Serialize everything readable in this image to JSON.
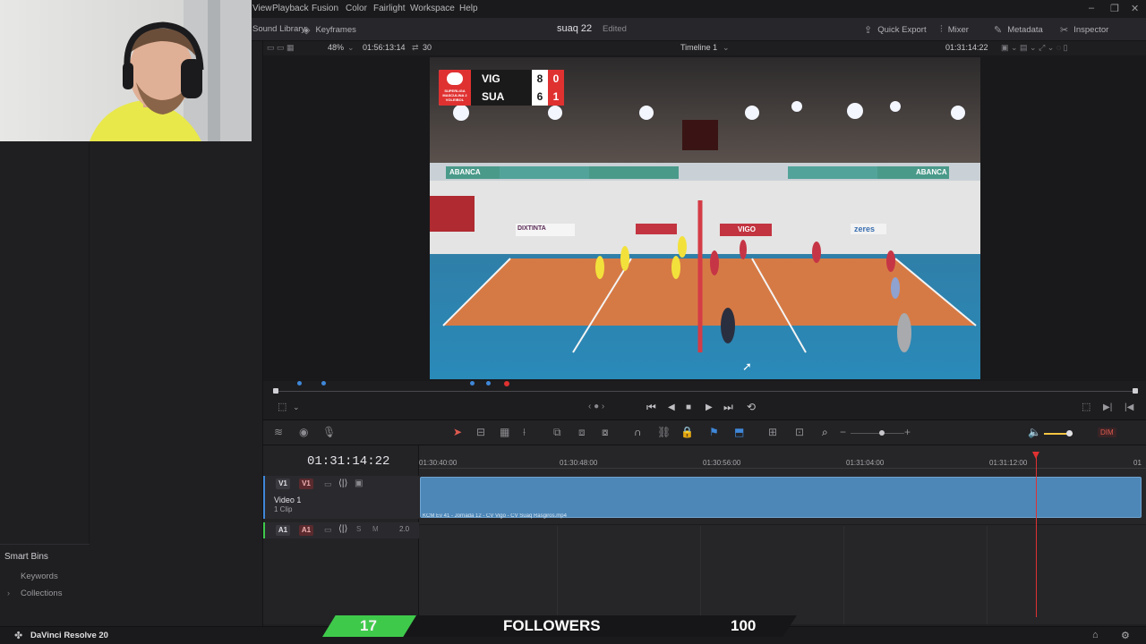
{
  "menu": {
    "items": [
      "View",
      "Playback",
      "Fusion",
      "Color",
      "Fairlight",
      "Workspace",
      "Help"
    ]
  },
  "toolbar": {
    "media_library": "Sound Library",
    "keyframes": "Keyframes",
    "project_title": "suaq 22",
    "project_status": "Edited",
    "quick_export": "Quick Export",
    "mixer": "Mixer",
    "metadata": "Metadata",
    "inspector": "Inspector"
  },
  "viewer": {
    "zoom": "48%",
    "source_timecode": "01:56:13:14",
    "fps": "30",
    "timeline_name": "Timeline 1",
    "record_timecode": "01:31:14:22"
  },
  "scoreboard": {
    "team1": "VIG",
    "team1_sets": "8",
    "team1_points": "0",
    "team2": "SUA",
    "team2_sets": "6",
    "team2_points": "1",
    "league": "SUPERLIGA MASCULINA 2 VOLEIBOL"
  },
  "court_banners": [
    "ABANCA",
    "ABANCA",
    "DIXTINTA",
    "VIGO",
    "zeres"
  ],
  "timeline": {
    "current_timecode": "01:31:14:22",
    "ruler_labels": [
      "01:30:40:00",
      "01:30:48:00",
      "01:30:56:00",
      "01:31:04:00",
      "01:31:12:00",
      "01"
    ],
    "video_track": {
      "tag1": "V1",
      "tag2": "V1",
      "name": "Video 1",
      "clips": "1 Clip",
      "clip_name": "KCM Ev 41 - Jornada 12 - CV Vigo - CV Suaq Rasgiros.mp4"
    },
    "audio_track": {
      "tag1": "A1",
      "tag2": "A1",
      "level": "2.0"
    },
    "dim_label": "DIM"
  },
  "smart_bins": {
    "title": "Smart Bins",
    "items": [
      "Keywords",
      "Collections"
    ]
  },
  "status": {
    "app_name": "DaVinci Resolve 20"
  },
  "followers": {
    "current": "17",
    "label": "FOLLOWERS",
    "goal": "100",
    "progress": 0.17
  },
  "colors": {
    "accent_red": "#e03131",
    "clip_blue": "#4d87b8",
    "green": "#3fc94b",
    "yellow": "#ffd640"
  }
}
